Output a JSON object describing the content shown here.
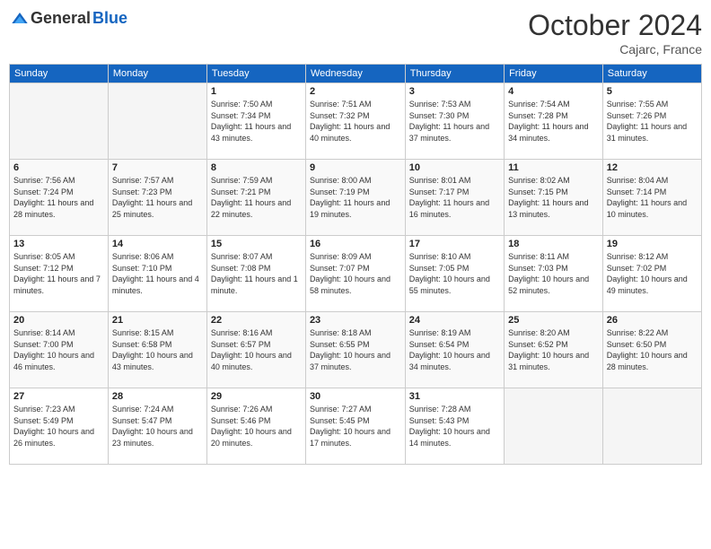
{
  "header": {
    "logo_general": "General",
    "logo_blue": "Blue",
    "month_title": "October 2024",
    "location": "Cajarc, France"
  },
  "days_of_week": [
    "Sunday",
    "Monday",
    "Tuesday",
    "Wednesday",
    "Thursday",
    "Friday",
    "Saturday"
  ],
  "weeks": [
    [
      {
        "day": "",
        "info": ""
      },
      {
        "day": "",
        "info": ""
      },
      {
        "day": "1",
        "info": "Sunrise: 7:50 AM\nSunset: 7:34 PM\nDaylight: 11 hours and 43 minutes."
      },
      {
        "day": "2",
        "info": "Sunrise: 7:51 AM\nSunset: 7:32 PM\nDaylight: 11 hours and 40 minutes."
      },
      {
        "day": "3",
        "info": "Sunrise: 7:53 AM\nSunset: 7:30 PM\nDaylight: 11 hours and 37 minutes."
      },
      {
        "day": "4",
        "info": "Sunrise: 7:54 AM\nSunset: 7:28 PM\nDaylight: 11 hours and 34 minutes."
      },
      {
        "day": "5",
        "info": "Sunrise: 7:55 AM\nSunset: 7:26 PM\nDaylight: 11 hours and 31 minutes."
      }
    ],
    [
      {
        "day": "6",
        "info": "Sunrise: 7:56 AM\nSunset: 7:24 PM\nDaylight: 11 hours and 28 minutes."
      },
      {
        "day": "7",
        "info": "Sunrise: 7:57 AM\nSunset: 7:23 PM\nDaylight: 11 hours and 25 minutes."
      },
      {
        "day": "8",
        "info": "Sunrise: 7:59 AM\nSunset: 7:21 PM\nDaylight: 11 hours and 22 minutes."
      },
      {
        "day": "9",
        "info": "Sunrise: 8:00 AM\nSunset: 7:19 PM\nDaylight: 11 hours and 19 minutes."
      },
      {
        "day": "10",
        "info": "Sunrise: 8:01 AM\nSunset: 7:17 PM\nDaylight: 11 hours and 16 minutes."
      },
      {
        "day": "11",
        "info": "Sunrise: 8:02 AM\nSunset: 7:15 PM\nDaylight: 11 hours and 13 minutes."
      },
      {
        "day": "12",
        "info": "Sunrise: 8:04 AM\nSunset: 7:14 PM\nDaylight: 11 hours and 10 minutes."
      }
    ],
    [
      {
        "day": "13",
        "info": "Sunrise: 8:05 AM\nSunset: 7:12 PM\nDaylight: 11 hours and 7 minutes."
      },
      {
        "day": "14",
        "info": "Sunrise: 8:06 AM\nSunset: 7:10 PM\nDaylight: 11 hours and 4 minutes."
      },
      {
        "day": "15",
        "info": "Sunrise: 8:07 AM\nSunset: 7:08 PM\nDaylight: 11 hours and 1 minute."
      },
      {
        "day": "16",
        "info": "Sunrise: 8:09 AM\nSunset: 7:07 PM\nDaylight: 10 hours and 58 minutes."
      },
      {
        "day": "17",
        "info": "Sunrise: 8:10 AM\nSunset: 7:05 PM\nDaylight: 10 hours and 55 minutes."
      },
      {
        "day": "18",
        "info": "Sunrise: 8:11 AM\nSunset: 7:03 PM\nDaylight: 10 hours and 52 minutes."
      },
      {
        "day": "19",
        "info": "Sunrise: 8:12 AM\nSunset: 7:02 PM\nDaylight: 10 hours and 49 minutes."
      }
    ],
    [
      {
        "day": "20",
        "info": "Sunrise: 8:14 AM\nSunset: 7:00 PM\nDaylight: 10 hours and 46 minutes."
      },
      {
        "day": "21",
        "info": "Sunrise: 8:15 AM\nSunset: 6:58 PM\nDaylight: 10 hours and 43 minutes."
      },
      {
        "day": "22",
        "info": "Sunrise: 8:16 AM\nSunset: 6:57 PM\nDaylight: 10 hours and 40 minutes."
      },
      {
        "day": "23",
        "info": "Sunrise: 8:18 AM\nSunset: 6:55 PM\nDaylight: 10 hours and 37 minutes."
      },
      {
        "day": "24",
        "info": "Sunrise: 8:19 AM\nSunset: 6:54 PM\nDaylight: 10 hours and 34 minutes."
      },
      {
        "day": "25",
        "info": "Sunrise: 8:20 AM\nSunset: 6:52 PM\nDaylight: 10 hours and 31 minutes."
      },
      {
        "day": "26",
        "info": "Sunrise: 8:22 AM\nSunset: 6:50 PM\nDaylight: 10 hours and 28 minutes."
      }
    ],
    [
      {
        "day": "27",
        "info": "Sunrise: 7:23 AM\nSunset: 5:49 PM\nDaylight: 10 hours and 26 minutes."
      },
      {
        "day": "28",
        "info": "Sunrise: 7:24 AM\nSunset: 5:47 PM\nDaylight: 10 hours and 23 minutes."
      },
      {
        "day": "29",
        "info": "Sunrise: 7:26 AM\nSunset: 5:46 PM\nDaylight: 10 hours and 20 minutes."
      },
      {
        "day": "30",
        "info": "Sunrise: 7:27 AM\nSunset: 5:45 PM\nDaylight: 10 hours and 17 minutes."
      },
      {
        "day": "31",
        "info": "Sunrise: 7:28 AM\nSunset: 5:43 PM\nDaylight: 10 hours and 14 minutes."
      },
      {
        "day": "",
        "info": ""
      },
      {
        "day": "",
        "info": ""
      }
    ]
  ]
}
